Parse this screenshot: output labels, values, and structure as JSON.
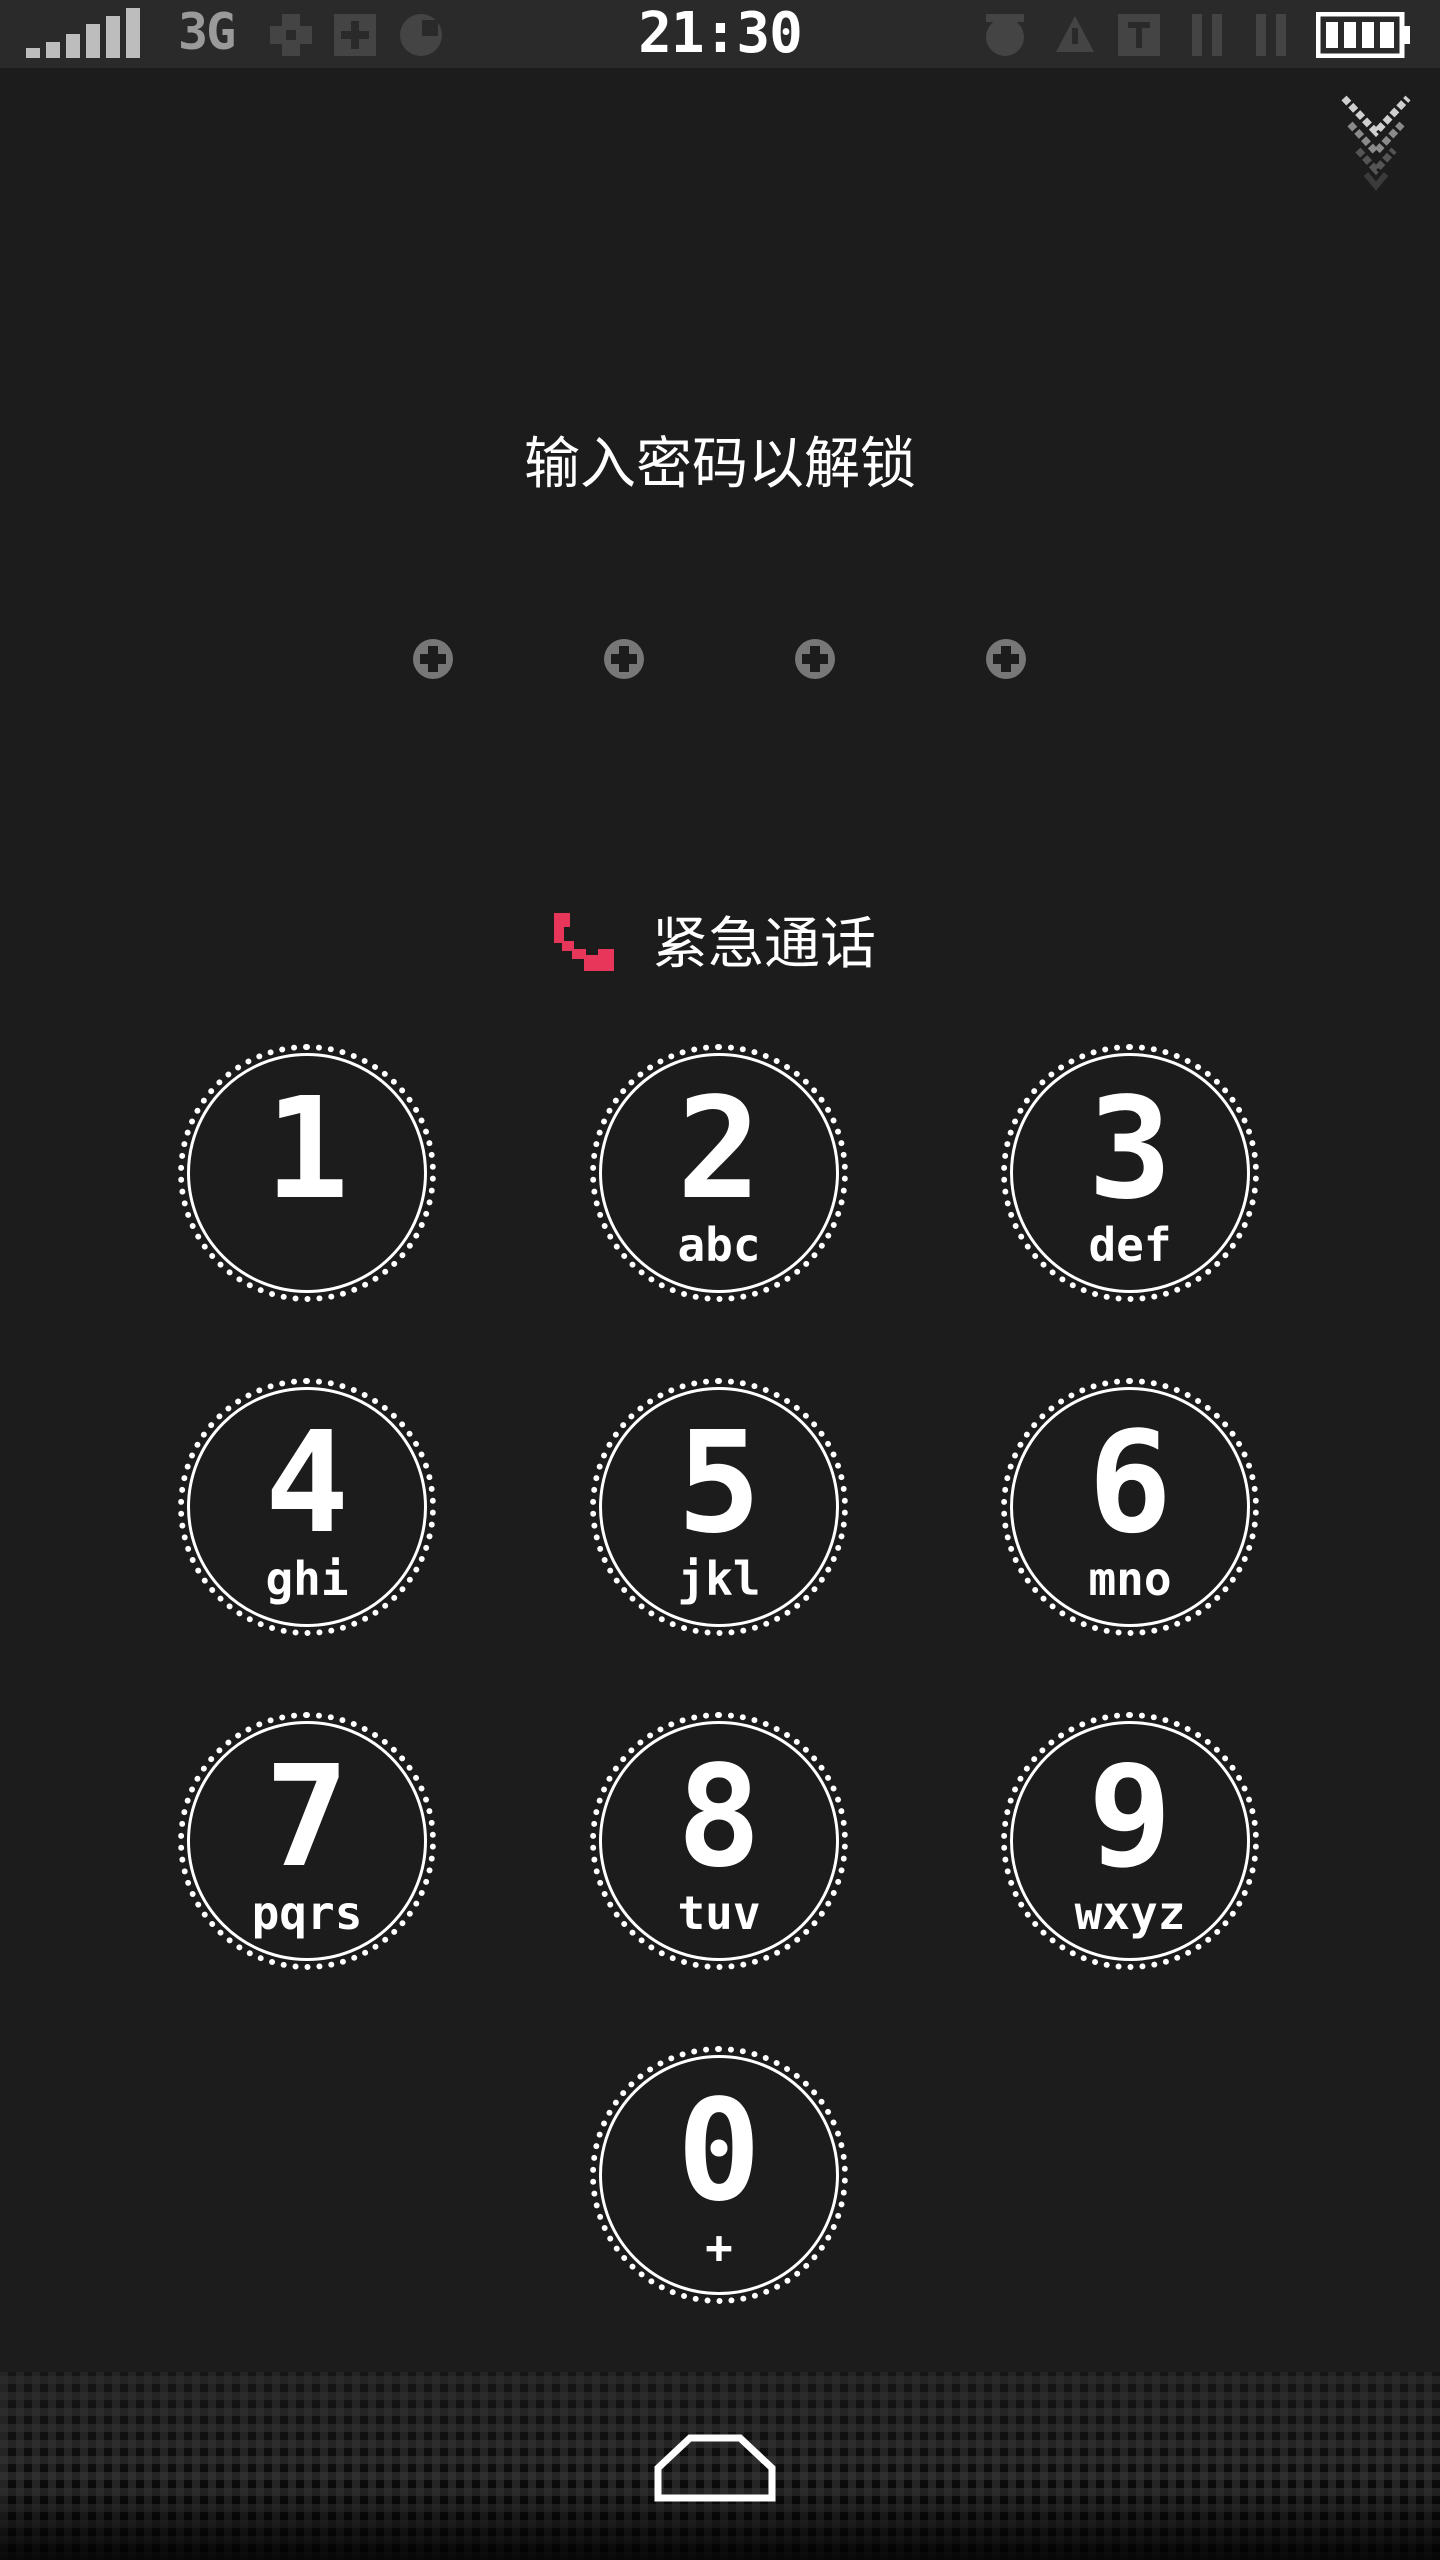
{
  "status_bar": {
    "network_type": "3G",
    "time": "21:30",
    "icons": [
      "signal-icon",
      "notification-icon",
      "notification-icon",
      "notification-icon",
      "alarm-icon",
      "vibrate-icon",
      "sim-icon",
      "wifi-icon",
      "battery-icon"
    ]
  },
  "lock_screen": {
    "prompt": "输入密码以解锁",
    "pin_length": 4,
    "emergency_label": "紧急通话",
    "emergency_color": "#e8365a"
  },
  "keypad": {
    "keys": [
      {
        "digit": "1",
        "letters": ""
      },
      {
        "digit": "2",
        "letters": "abc"
      },
      {
        "digit": "3",
        "letters": "def"
      },
      {
        "digit": "4",
        "letters": "ghi"
      },
      {
        "digit": "5",
        "letters": "jkl"
      },
      {
        "digit": "6",
        "letters": "mno"
      },
      {
        "digit": "7",
        "letters": "pqrs"
      },
      {
        "digit": "8",
        "letters": "tuv"
      },
      {
        "digit": "9",
        "letters": "wxyz"
      },
      {
        "digit": "0",
        "letters": "+"
      }
    ]
  }
}
